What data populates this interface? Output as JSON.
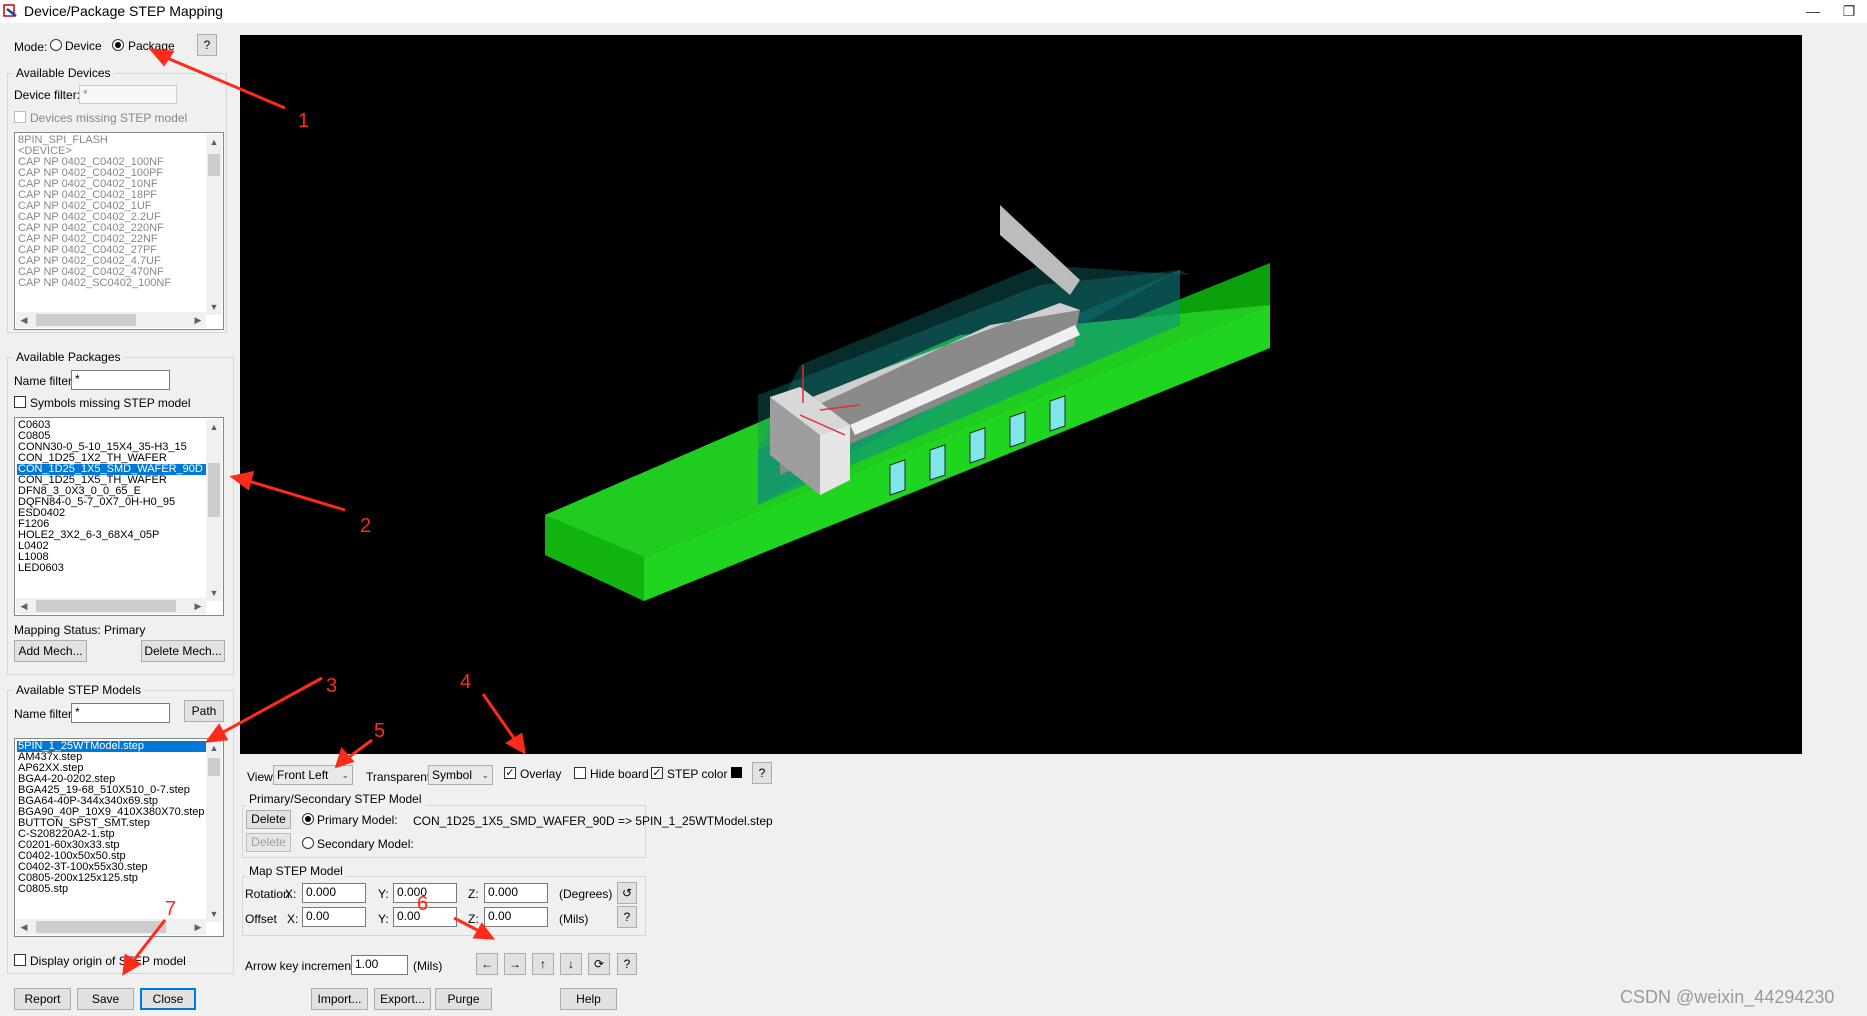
{
  "window": {
    "title": "Device/Package STEP Mapping"
  },
  "mode": {
    "label": "Mode:",
    "options": [
      "Device",
      "Package"
    ],
    "selected": "Package",
    "help": "?"
  },
  "available_devices": {
    "legend": "Available Devices",
    "filter_label": "Device filter:",
    "filter_value": "*",
    "missing_label": "Devices missing STEP model",
    "items": [
      "8PIN_SPI_FLASH",
      "<DEVICE>",
      "CAP NP 0402_C0402_100NF",
      "CAP NP 0402_C0402_100PF",
      "CAP NP 0402_C0402_10NF",
      "CAP NP 0402_C0402_18PF",
      "CAP NP 0402_C0402_1UF",
      "CAP NP 0402_C0402_2.2UF",
      "CAP NP 0402_C0402_220NF",
      "CAP NP 0402_C0402_22NF",
      "CAP NP 0402_C0402_27PF",
      "CAP NP 0402_C0402_4.7UF",
      "CAP NP 0402_C0402_470NF",
      "CAP NP 0402_SC0402_100NF"
    ]
  },
  "available_packages": {
    "legend": "Available Packages",
    "filter_label": "Name filter:",
    "filter_value": "*",
    "missing_label": "Symbols missing STEP model",
    "items": [
      "C0603",
      "C0805",
      "CONN30-0_5-10_15X4_35-H3_15",
      "CON_1D25_1X2_TH_WAFER",
      "CON_1D25_1X5_SMD_WAFER_90D",
      "CON_1D25_1X5_TH_WAFER",
      "DFN8_3_0X3_0_0_65_E",
      "DQFN84-0_5-7_0X7_0H-H0_95",
      "ESD0402",
      "F1206",
      "HOLE2_3X2_6-3_68X4_05P",
      "L0402",
      "L1008",
      "LED0603"
    ],
    "selected_index": 4,
    "mapping_status": "Mapping Status: Primary",
    "add_mech": "Add Mech...",
    "delete_mech": "Delete Mech..."
  },
  "available_step": {
    "legend": "Available STEP Models",
    "filter_label": "Name filter:",
    "filter_value": "*",
    "path_button": "Path",
    "items": [
      "5PIN_1_25WTModel.step",
      "AM437x.step",
      "AP62XX.step",
      "BGA4-20-0202.step",
      "BGA425_19-68_510X510_0-7.step",
      "BGA64-40P-344x340x69.stp",
      "BGA90_40P_10X9_410X380X70.step",
      "BUTTON_SPST_SMT.step",
      "C-S208220A2-1.stp",
      "C0201-60x30x33.stp",
      "C0402-100x50x50.stp",
      "C0402-3T-100x55x30.step",
      "C0805-200x125x125.stp",
      "C0805.stp"
    ],
    "selected_index": 0,
    "display_origin": "Display origin of STEP model"
  },
  "bottom_buttons": {
    "report": "Report",
    "save": "Save",
    "close": "Close",
    "import": "Import...",
    "export": "Export...",
    "purge": "Purge",
    "help": "Help"
  },
  "view_bar": {
    "view_label": "View:",
    "view_value": "Front Left",
    "transparent_label": "Transparent:",
    "transparent_value": "Symbol",
    "overlay": "Overlay",
    "overlay_checked": true,
    "hide_board": "Hide board",
    "hide_board_checked": false,
    "step_color": "STEP color",
    "step_color_checked": true,
    "step_color_swatch": "#000000",
    "help": "?"
  },
  "primary_secondary": {
    "legend": "Primary/Secondary STEP Model",
    "delete": "Delete",
    "primary_label": "Primary Model:",
    "primary_mapping": "CON_1D25_1X5_SMD_WAFER_90D => 5PIN_1_25WTModel.step",
    "secondary_label": "Secondary Model:"
  },
  "map_step": {
    "legend": "Map STEP Model",
    "rotation_label": "Rotation",
    "offset_label": "Offset",
    "x_label": "X:",
    "y_label": "Y:",
    "z_label": "Z:",
    "rotation": {
      "x": "0.000",
      "y": "0.000",
      "z": "0.000"
    },
    "offset": {
      "x": "0.00",
      "y": "0.00",
      "z": "0.00"
    },
    "rotation_unit": "(Degrees)",
    "offset_unit": "(Mils)",
    "help": "?"
  },
  "arrow_key": {
    "label": "Arrow key increment:",
    "value": "1.00",
    "unit": "(Mils)",
    "help": "?"
  },
  "annotations": [
    "1",
    "2",
    "3",
    "4",
    "5",
    "6",
    "7"
  ],
  "watermark": "CSDN @weixin_44294230",
  "colors": {
    "board": "#1ec81e",
    "pcb_green": "#00c800",
    "body": "#d8d8d8",
    "pins": "#7ee6e6",
    "annotation": "#ff2a1a",
    "selection": "#0078d7"
  }
}
